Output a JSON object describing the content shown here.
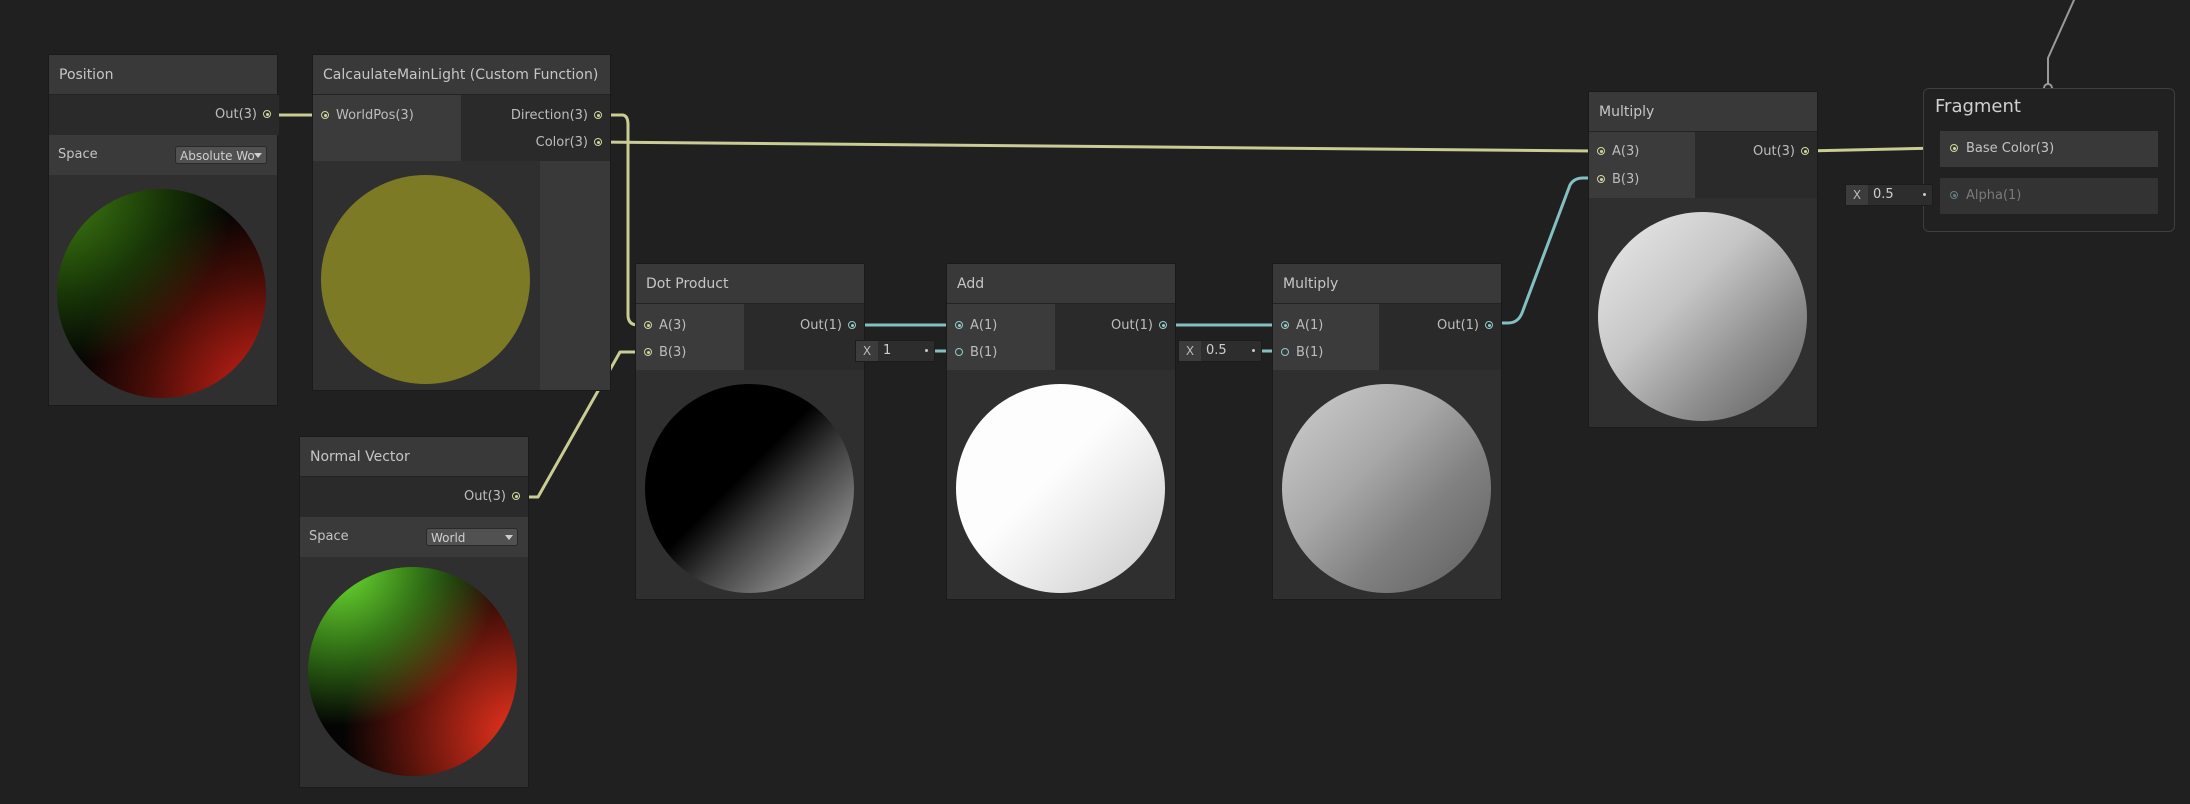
{
  "nodes": {
    "position": {
      "title": "Position",
      "out_label": "Out(3)",
      "space_label": "Space",
      "space_value": "Absolute Wo"
    },
    "custom_function": {
      "title": "CalcaulateMainLight (Custom Function)",
      "in_label": "WorldPos(3)",
      "out_direction": "Direction(3)",
      "out_color": "Color(3)"
    },
    "normal_vector": {
      "title": "Normal Vector",
      "out_label": "Out(3)",
      "space_label": "Space",
      "space_value": "World"
    },
    "dot_product": {
      "title": "Dot Product",
      "in_a": "A(3)",
      "in_b": "B(3)",
      "out": "Out(1)"
    },
    "add": {
      "title": "Add",
      "in_a": "A(1)",
      "in_b": "B(1)",
      "out": "Out(1)",
      "b_input_axis": "X",
      "b_input_value": "1"
    },
    "multiply_1": {
      "title": "Multiply",
      "in_a": "A(1)",
      "in_b": "B(1)",
      "out": "Out(1)",
      "b_input_axis": "X",
      "b_input_value": "0.5"
    },
    "multiply_2": {
      "title": "Multiply",
      "in_a": "A(3)",
      "in_b": "B(3)",
      "out": "Out(3)"
    }
  },
  "master": {
    "title": "Fragment",
    "base_color": "Base Color(3)",
    "alpha": "Alpha(1)",
    "alpha_input_axis": "X",
    "alpha_input_value": "0.5"
  },
  "colors": {
    "background": "#202020",
    "node": "#393939",
    "wire_vector3": "#c9cc94",
    "wire_vector1": "#84c0c0",
    "wire_master": "#9a9a9a"
  }
}
